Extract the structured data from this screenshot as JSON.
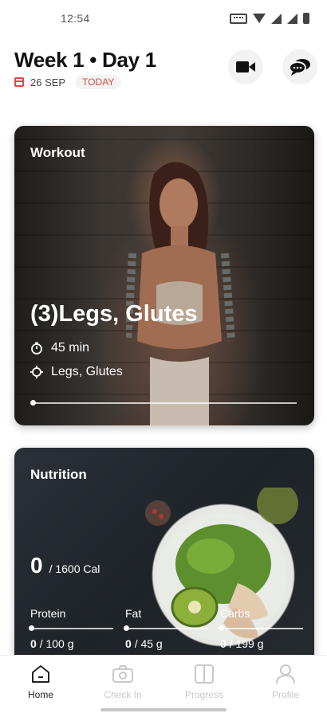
{
  "status_bar": {
    "time": "12:54"
  },
  "header": {
    "title": "Week 1 • Day 1",
    "date": "26 SEP",
    "today_badge": "TODAY"
  },
  "workout": {
    "label": "Workout",
    "title": "(3)Legs, Glutes",
    "duration": "45 min",
    "target": "Legs, Glutes",
    "progress": 0
  },
  "nutrition": {
    "label": "Nutrition",
    "calories": "0",
    "calorie_goal": "/ 1600 Cal",
    "macros": [
      {
        "label": "Protein",
        "current": "0",
        "goal": "/ 100 g",
        "progress": 0
      },
      {
        "label": "Fat",
        "current": "0",
        "goal": "/ 45 g",
        "progress": 0
      },
      {
        "label": "Carbs",
        "current": "0",
        "goal": "/ 199 g",
        "progress": 0
      }
    ]
  },
  "nav": {
    "items": [
      {
        "label": "Home",
        "icon": "home-icon",
        "active": true
      },
      {
        "label": "Check In",
        "icon": "camera-icon",
        "active": false
      },
      {
        "label": "Progress",
        "icon": "progress-icon",
        "active": false
      },
      {
        "label": "Profile",
        "icon": "profile-icon",
        "active": false
      }
    ]
  },
  "colors": {
    "accent": "#e04848",
    "active_nav": "#222222",
    "inactive_nav": "#c8c8c8"
  }
}
